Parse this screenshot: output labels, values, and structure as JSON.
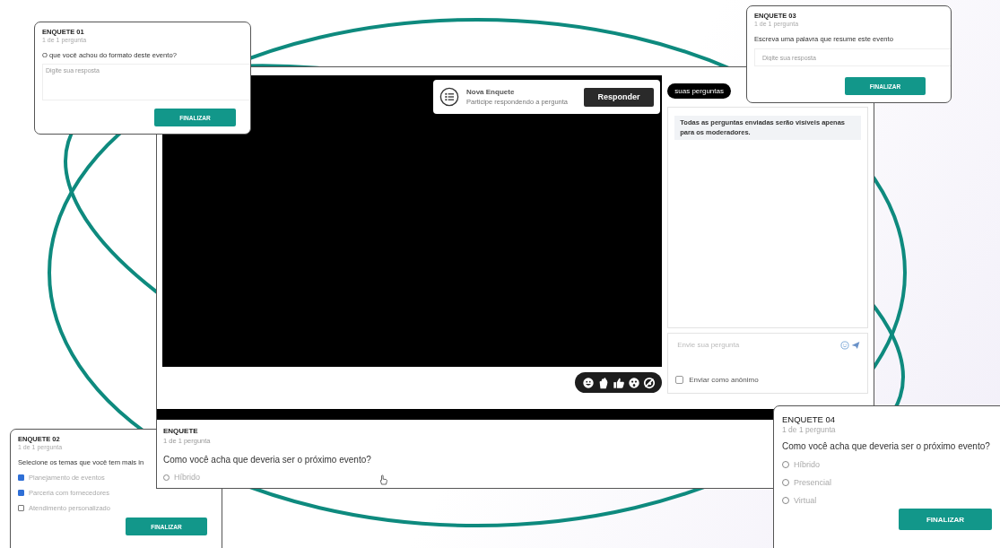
{
  "main_window": {
    "poll_popup": {
      "title": "Nova Enquete",
      "subtitle": "Participe respondendo a pergunta",
      "button": "Responder"
    },
    "tabs": [
      {
        "label": "suas perguntas",
        "selected": true
      }
    ],
    "notice": "Todas as perguntas enviadas serão visíveis apenas para os moderadores.",
    "question_input": {
      "placeholder": "Envie sua pergunta"
    },
    "anonymous": {
      "label": "Enviar como anônimo",
      "checked": false
    },
    "poll": {
      "title": "ENQUETE",
      "subtitle": "1 de 1 pergunta",
      "question": "Como você acha que deveria ser o próximo evento?",
      "options": [
        {
          "label": "Híbrido",
          "selected": false
        }
      ]
    }
  },
  "cards": [
    {
      "title": "ENQUETE 01",
      "subtitle": "1 de 1 pergunta",
      "question": "O que você achou do formato deste evento?",
      "kind": "textarea",
      "placeholder": "Digite sua resposta",
      "button": "FINALIZAR"
    },
    {
      "title": "ENQUETE 03",
      "subtitle": "1 de 1 pergunta",
      "question": "Escreva uma palavra que resume este evento",
      "kind": "input",
      "placeholder": "Digite sua resposta",
      "button": "FINALIZAR"
    },
    {
      "title": "ENQUETE 02",
      "subtitle": "1 de 1 pergunta",
      "question": "Selecione os temas que você tem mais in",
      "kind": "checkbox",
      "options": [
        {
          "label": "Planejamento de eventos",
          "checked": true
        },
        {
          "label": "Parceria com fornecedores",
          "checked": true
        },
        {
          "label": "Atendimento personalizado",
          "checked": false
        }
      ],
      "button": "FINALIZAR"
    },
    {
      "title": "ENQUETE 04",
      "subtitle": "1 de 1 pergunta",
      "question": "Como você acha que deveria ser o próximo evento?",
      "kind": "radio",
      "options": [
        {
          "label": "Híbrido",
          "selected": false
        },
        {
          "label": "Presencial",
          "selected": false
        },
        {
          "label": "Virtual",
          "selected": false
        }
      ],
      "button": "FINALIZAR"
    }
  ]
}
